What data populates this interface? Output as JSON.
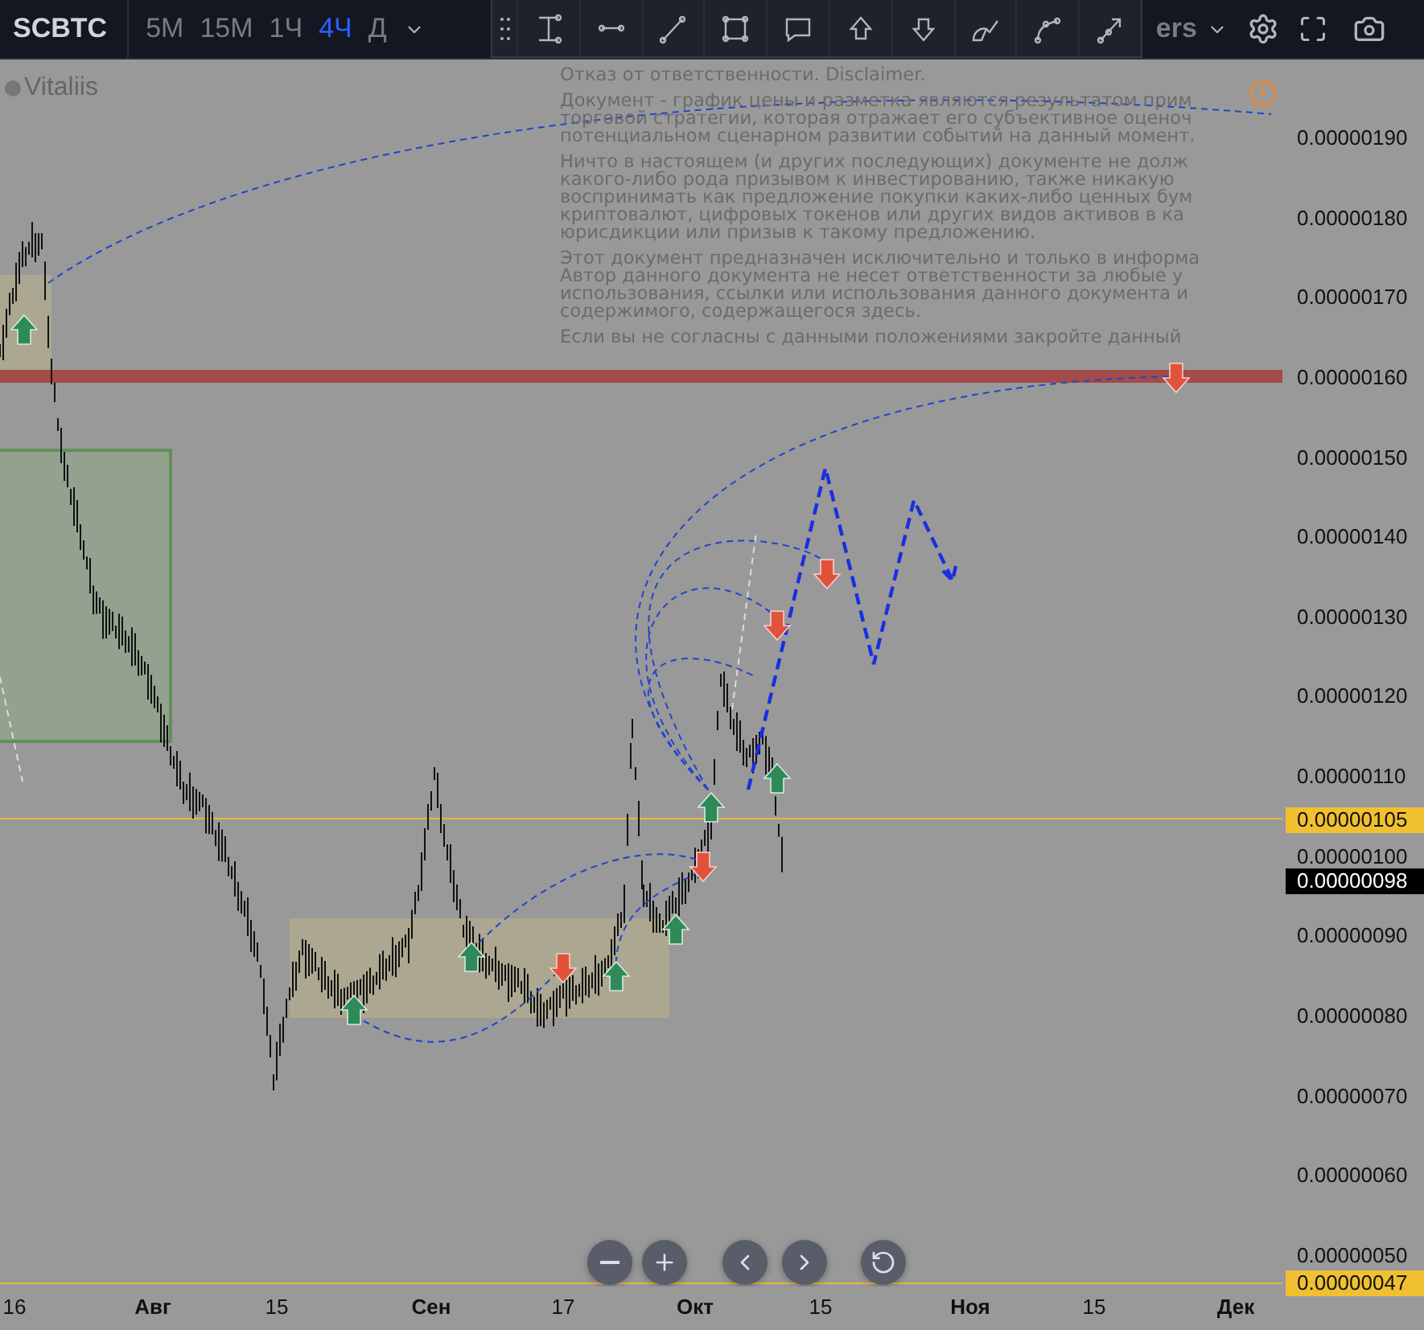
{
  "toolbar": {
    "symbol": "SCBTC",
    "intervals": [
      {
        "label": "5M",
        "selected": false
      },
      {
        "label": "15M",
        "selected": false
      },
      {
        "label": "1Ч",
        "selected": false
      },
      {
        "label": "4Ч",
        "selected": true
      },
      {
        "label": "Д",
        "selected": false
      }
    ],
    "indicators_label": "ers"
  },
  "chart": {
    "legend": "Vitaliis",
    "disclaimer": [
      [
        "Отказ от ответственности. Disclaimer."
      ],
      [
        "Документ - график цены и разметка являются результатом прим",
        "торговой стратегии, которая отражает его субъективное оценоч",
        "потенциальном сценарном развитии событий на данный момент."
      ],
      [
        "Ничто в настоящем (и других последующих) документе не долж",
        "какого-либо рода призывом к инвестированию, также никакую",
        "воспринимать как предложение покупки каких-либо ценных бум",
        "криптовалют, цифровых токенов или других видов активов в ка",
        "юрисдикции или призыв к такому предложению."
      ],
      [
        "Этот документ предназначен исключительно и только в информа",
        "Автор данного документа не несет ответственности за любые у",
        "использования, ссылки или использования данного документа и",
        "содержимого, содержащегося здесь."
      ],
      [
        "Если вы не согласны с данными положениями закройте данный"
      ]
    ]
  },
  "price_axis": {
    "labels": [
      "0.00000190",
      "0.00000180",
      "0.00000170",
      "0.00000160",
      "0.00000150",
      "0.00000140",
      "0.00000130",
      "0.00000120",
      "0.00000110",
      "0.00000100",
      "0.00000090",
      "0.00000080",
      "0.00000070",
      "0.00000060",
      "0.00000050"
    ],
    "tags": [
      {
        "text": "0.00000105",
        "kind": "line"
      },
      {
        "text": "0.00000098",
        "kind": "last"
      },
      {
        "text": "0.00000047",
        "kind": "line"
      }
    ]
  },
  "time_axis": [
    {
      "text": "16",
      "kind": "day"
    },
    {
      "text": "Авг",
      "kind": "month"
    },
    {
      "text": "15",
      "kind": "day"
    },
    {
      "text": "Сен",
      "kind": "month"
    },
    {
      "text": "17",
      "kind": "day"
    },
    {
      "text": "Окт",
      "kind": "month"
    },
    {
      "text": "15",
      "kind": "day"
    },
    {
      "text": "Ноя",
      "kind": "month"
    },
    {
      "text": "15",
      "kind": "day"
    },
    {
      "text": "Дек",
      "kind": "month"
    }
  ]
}
